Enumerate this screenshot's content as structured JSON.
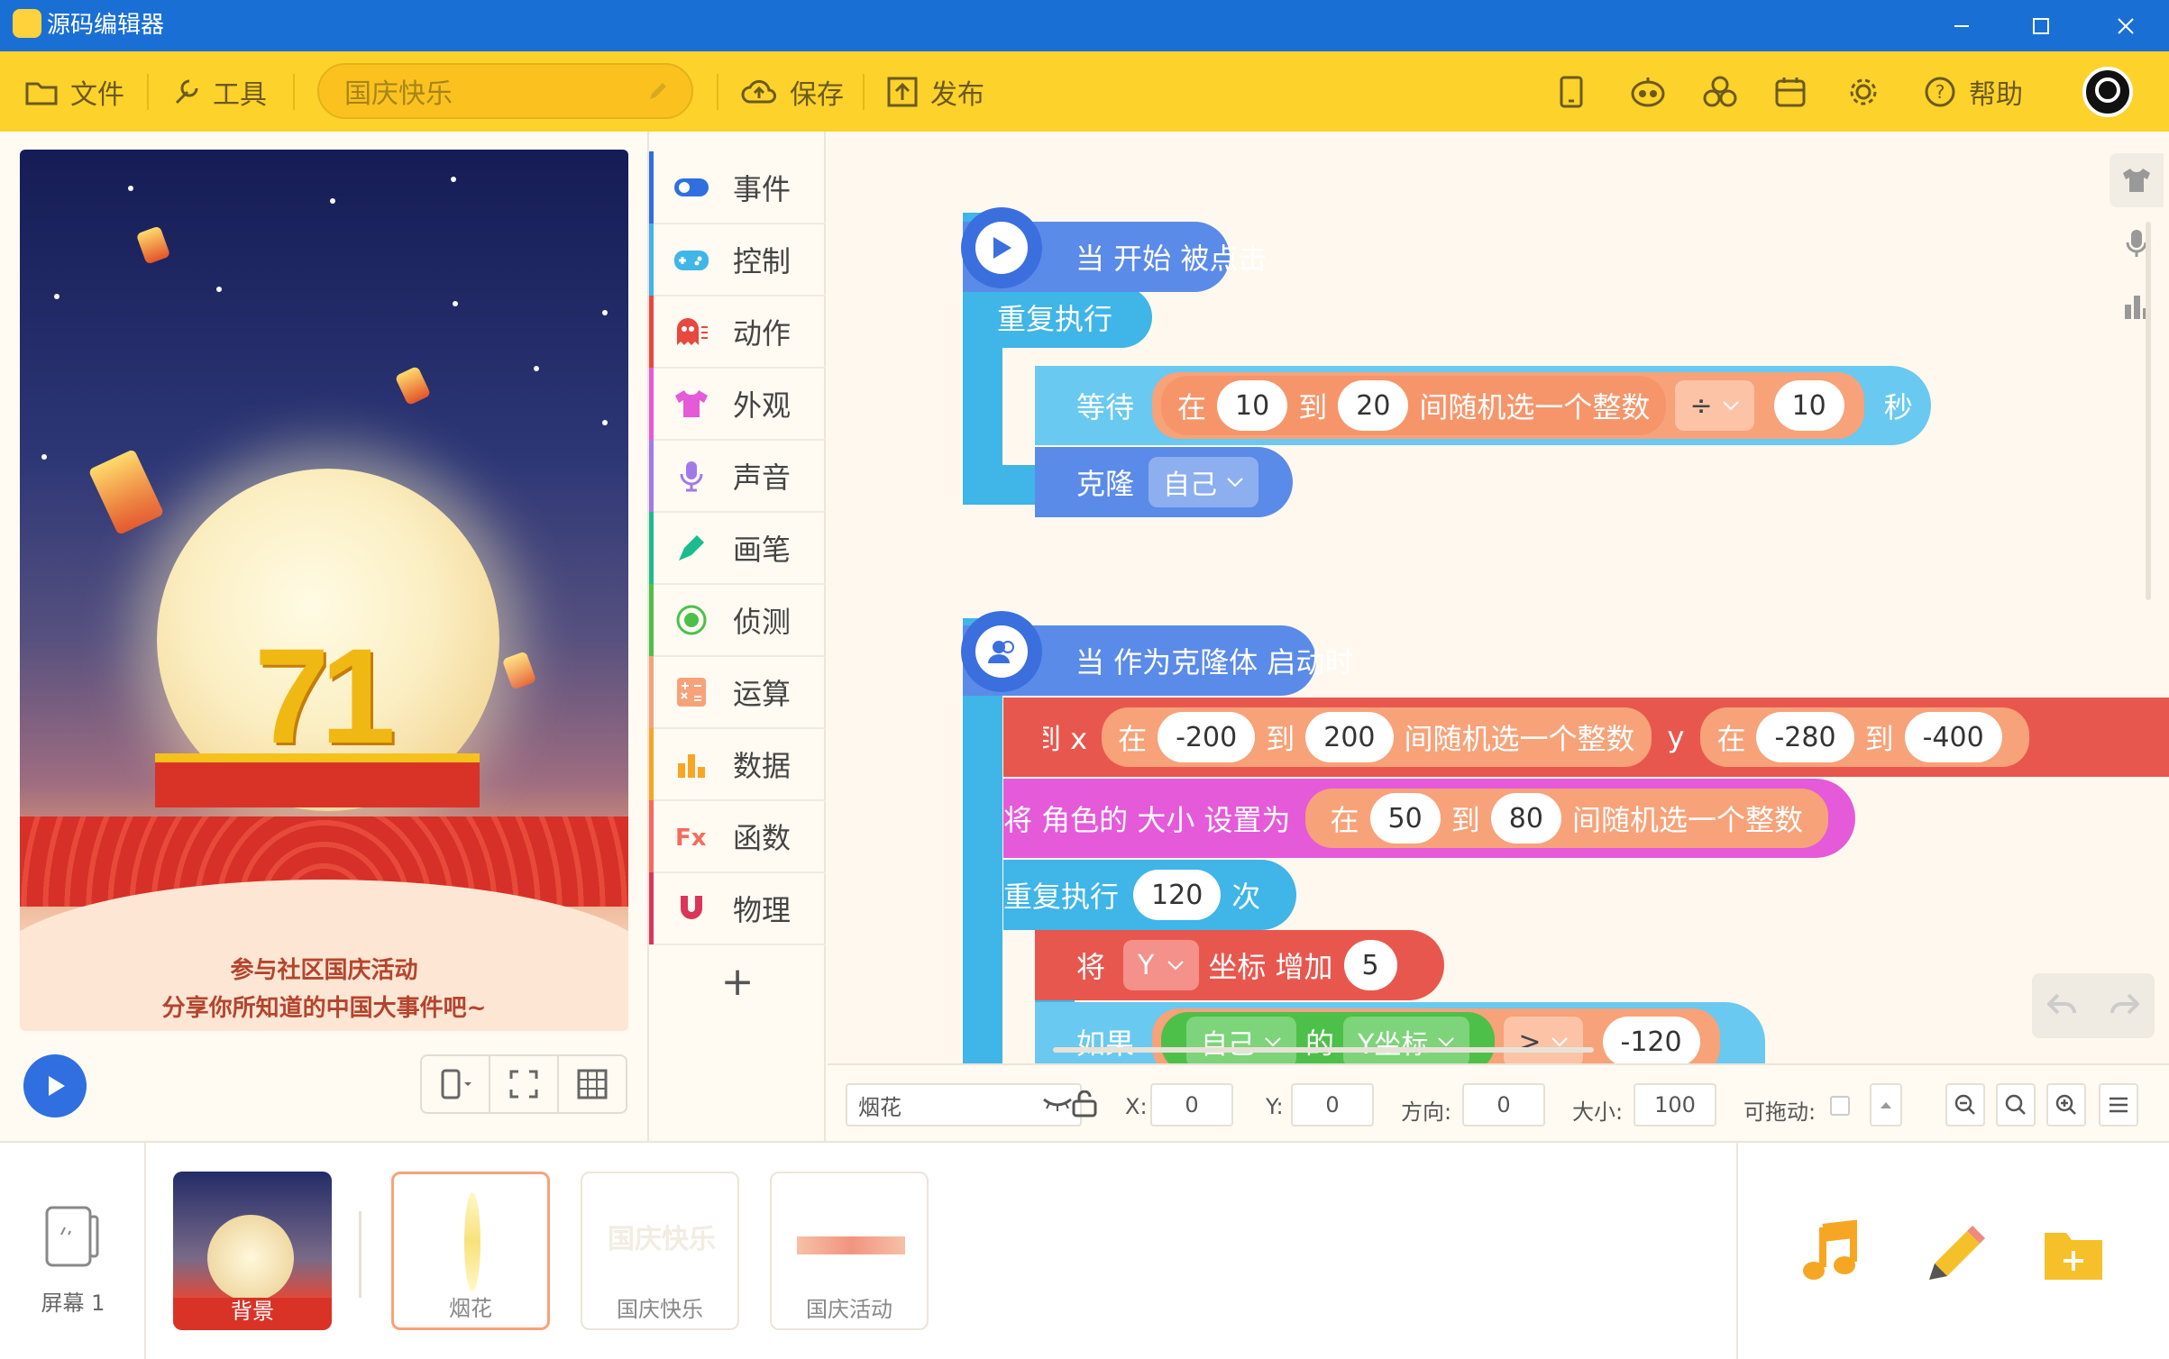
{
  "window": {
    "title": "源码编辑器",
    "minimize": "—",
    "maximize": "☐",
    "close": "✕"
  },
  "toolbar": {
    "file": "文件",
    "tools": "工具",
    "project_name": "国庆快乐",
    "save": "保存",
    "publish": "发布",
    "help": "帮助",
    "icons": [
      "phone-icon",
      "robot-icon",
      "hexagon-blocks-icon",
      "device-icon",
      "gear-icon"
    ]
  },
  "stage": {
    "caption_line1": "参与社区国庆活动",
    "caption_line2": "分享你所知道的中国大事件吧~",
    "number": "71"
  },
  "categories": [
    {
      "label": "事件",
      "color": "#2f6fe0",
      "icon": "toggle-icon"
    },
    {
      "label": "控制",
      "color": "#3fb5e8",
      "icon": "gamepad-icon"
    },
    {
      "label": "动作",
      "color": "#e8483e",
      "icon": "ghost-icon"
    },
    {
      "label": "外观",
      "color": "#e55ad9",
      "icon": "shirt-icon"
    },
    {
      "label": "声音",
      "color": "#a27ae8",
      "icon": "mic-icon"
    },
    {
      "label": "画笔",
      "color": "#1bbc8c",
      "icon": "brush-icon"
    },
    {
      "label": "侦测",
      "color": "#4dc04a",
      "icon": "target-icon"
    },
    {
      "label": "运算",
      "color": "#f7a279",
      "icon": "calc-icon"
    },
    {
      "label": "数据",
      "color": "#f6a623",
      "icon": "bars-icon"
    },
    {
      "label": "函数",
      "color": "#f46b5f",
      "icon": "fx-icon"
    },
    {
      "label": "物理",
      "color": "#d9365a",
      "icon": "magnet-icon"
    }
  ],
  "add_category": "+",
  "blocks": {
    "hat1": "当 开始 被点击",
    "repeat1": "重复执行",
    "wait": "等待",
    "rand_at": "在",
    "rand_to": "到",
    "rand_text": "间随机选一个整数",
    "wait_a": "10",
    "wait_b": "20",
    "div_op": "÷",
    "div_val": "10",
    "sec": "秒",
    "clone": "克隆",
    "clone_target": "自己",
    "hat2": "当 作为克隆体 启动时",
    "goto": "移到 x",
    "goto_x_a": "-200",
    "goto_x_b": "200",
    "goto_y": "y",
    "goto_y_a": "-280",
    "goto_y_b": "-400",
    "setsize": "将 角色的 大小 设置为",
    "size_a": "50",
    "size_b": "80",
    "repeat2": "重复执行",
    "repeat2_n": "120",
    "times": "次",
    "change": "将",
    "change_axis": "Y",
    "change_text": "坐标 增加",
    "change_val": "5",
    "if": "如果",
    "if_obj": "自己",
    "if_of": "的",
    "if_prop": "Y坐标",
    "if_op": ">",
    "if_val": "-120"
  },
  "props": {
    "sprite_name": "烟花",
    "x_label": "X:",
    "x": "0",
    "y_label": "Y:",
    "y": "0",
    "dir_label": "方向:",
    "dir": "0",
    "size_label": "大小:",
    "size": "100",
    "drag_label": "可拖动:"
  },
  "sprites": {
    "screen_label": "屏幕 1",
    "items": [
      "背景",
      "烟花",
      "国庆快乐",
      "国庆活动"
    ]
  },
  "colors": {
    "accent": "#fdd22b",
    "titlebar": "#1a6fd5"
  }
}
